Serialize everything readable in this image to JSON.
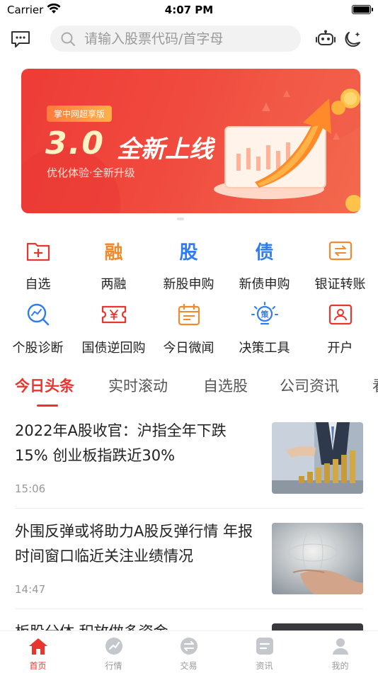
{
  "status_bar": {
    "carrier": "Carrier",
    "time": "4:07 PM"
  },
  "top_bar": {
    "search_placeholder": "请输入股票代码/首字母",
    "icons": [
      "message-icon",
      "search-icon",
      "robot-icon",
      "moon-icon"
    ]
  },
  "banner": {
    "tag": "掌中网超享版",
    "headline_number": "3.0",
    "headline_text": "全新上线",
    "subtitle": "优化体验·全新升级"
  },
  "quick_grid": [
    {
      "label": "自选",
      "icon": "folder-plus-icon",
      "color": "#e8362f"
    },
    {
      "label": "两融",
      "icon": "rong-char-icon",
      "glyph": "融",
      "color": "#f08a2c"
    },
    {
      "label": "新股申购",
      "icon": "gu-char-icon",
      "glyph": "股",
      "color": "#2f7cf0"
    },
    {
      "label": "新债申购",
      "icon": "zhai-char-icon",
      "glyph": "债",
      "color": "#2f7cf0"
    },
    {
      "label": "银证转账",
      "icon": "transfer-icon",
      "color": "#f08a2c"
    },
    {
      "label": "个股诊断",
      "icon": "diagnosis-icon",
      "color": "#2f7cf0"
    },
    {
      "label": "国债逆回购",
      "icon": "ticket-yuan-icon",
      "color": "#e8362f"
    },
    {
      "label": "今日微闻",
      "icon": "calendar-icon",
      "color": "#f08a2c"
    },
    {
      "label": "决策工具",
      "icon": "bulb-icon",
      "glyph": "策",
      "color": "#2f7cf0"
    },
    {
      "label": "开户",
      "icon": "id-card-icon",
      "color": "#e8362f"
    }
  ],
  "tabs": [
    {
      "label": "今日头条",
      "active": true
    },
    {
      "label": "实时滚动"
    },
    {
      "label": "自选股"
    },
    {
      "label": "公司资讯"
    },
    {
      "label": "看"
    }
  ],
  "news": [
    {
      "title": "2022年A股收官：沪指全年下跌15% 创业板指跌近30%",
      "time": "15:06",
      "thumb": "business-coins-photo"
    },
    {
      "title": "外围反弹或将助力A股反弹行情 年报时间窗口临近关注业绩情况",
      "time": "14:47",
      "thumb": "hand-globe-photo"
    },
    {
      "title": "板股分体 积放做多资金",
      "time": "",
      "thumb": "dark-photo"
    }
  ],
  "tabbar": [
    {
      "label": "首页",
      "icon": "home-icon",
      "active": true
    },
    {
      "label": "行情",
      "icon": "market-icon"
    },
    {
      "label": "交易",
      "icon": "trade-icon"
    },
    {
      "label": "资讯",
      "icon": "news-icon"
    },
    {
      "label": "我的",
      "icon": "profile-icon"
    }
  ],
  "colors": {
    "accent": "#e8362f",
    "blue": "#2f7cf0",
    "orange": "#f08a2c"
  }
}
